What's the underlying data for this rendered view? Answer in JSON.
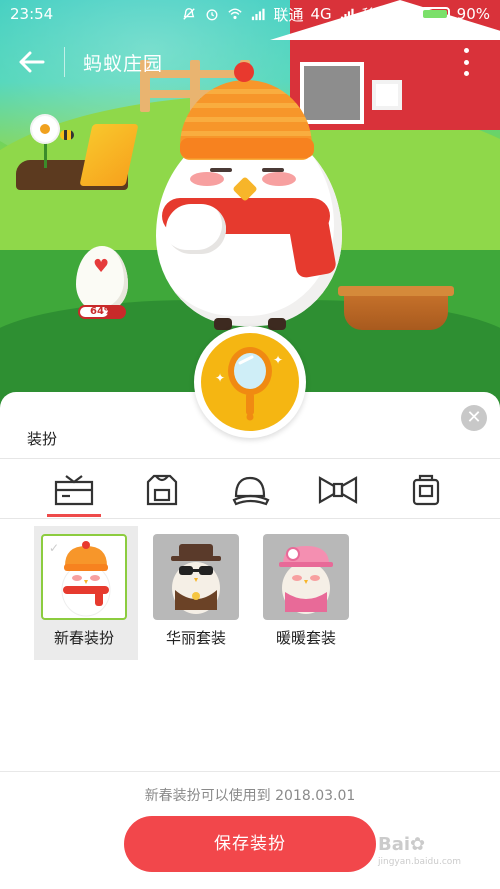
{
  "statusbar": {
    "time": "23:54",
    "carrier1": "联通",
    "network": "4G",
    "carrier2": "移动",
    "battery": "90%"
  },
  "header": {
    "title": "蚂蚁庄园"
  },
  "scene": {
    "egg_progress_label": "64%",
    "egg_progress_value": 64
  },
  "sheet": {
    "title": "装扮",
    "tabs": [
      {
        "id": "tab-outfit",
        "icon": "outfit-box-icon"
      },
      {
        "id": "tab-top",
        "icon": "jacket-icon"
      },
      {
        "id": "tab-hat",
        "icon": "cap-icon"
      },
      {
        "id": "tab-bowtie",
        "icon": "bowtie-icon"
      },
      {
        "id": "tab-bag",
        "icon": "bag-icon"
      }
    ],
    "items": [
      {
        "label": "新春装扮",
        "selected": true
      },
      {
        "label": "华丽套装",
        "selected": false
      },
      {
        "label": "暖暖套装",
        "selected": false
      }
    ],
    "expire_text": "新春装扮可以使用到 2018.03.01",
    "save_label": "保存装扮"
  },
  "watermark": {
    "text": "Bai",
    "subtext": "jingyan.baidu.com"
  },
  "colors": {
    "accent_red": "#f2474b",
    "tab_indicator": "#ee4a4a",
    "selected_border": "#8ccc3f",
    "mirror_gold": "#f5b612"
  }
}
